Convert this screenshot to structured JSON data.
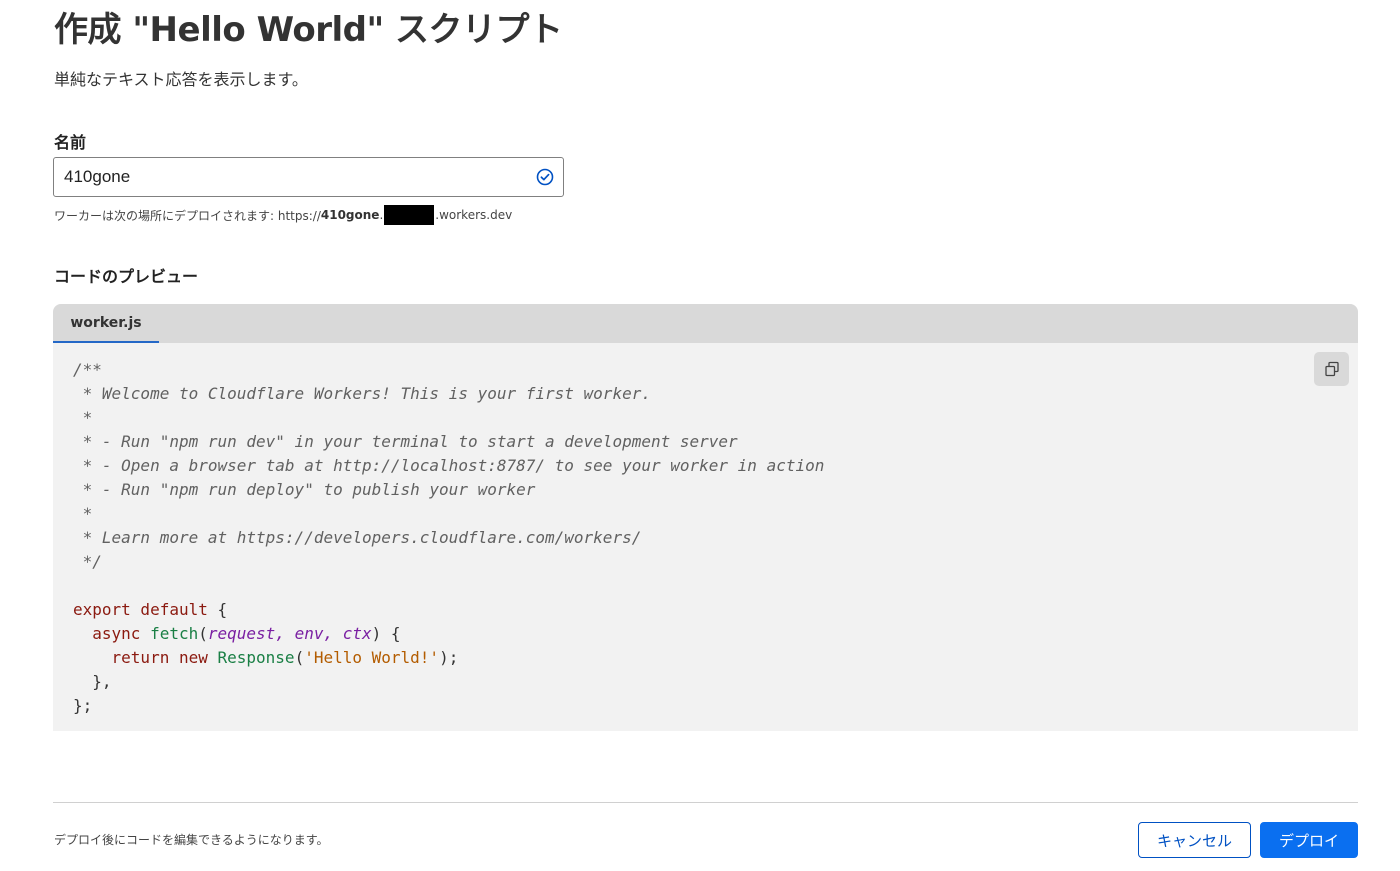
{
  "header": {
    "title": "作成 \"Hello World\" スクリプト",
    "subtitle": "単純なテキスト応答を表示します。"
  },
  "name_field": {
    "label": "名前",
    "value": "410gone",
    "status_icon": "check-circle-icon",
    "hint_prefix": "ワーカーは次の場所にデプロイされます: https://",
    "hint_name": "410gone",
    "hint_dot": ".",
    "hint_suffix": ".workers.dev"
  },
  "code_preview": {
    "label": "コードのプレビュー",
    "tab": "worker.js",
    "copy_icon": "copy-icon",
    "lines": {
      "l1": "/**",
      "l2": " * Welcome to Cloudflare Workers! This is your first worker.",
      "l3": " *",
      "l4": " * - Run \"npm run dev\" in your terminal to start a development server",
      "l5": " * - Open a browser tab at http://localhost:8787/ to see your worker in action",
      "l6": " * - Run \"npm run deploy\" to publish your worker",
      "l7": " *",
      "l8": " * Learn more at https://developers.cloudflare.com/workers/",
      "l9": " */",
      "l11_kw": "export default",
      "l11_rest": " {",
      "l12_kw": "  async ",
      "l12_fn": "fetch",
      "l12_open": "(",
      "l12_p1": "request",
      "l12_c1": ", ",
      "l12_p2": "env",
      "l12_c2": ", ",
      "l12_p3": "ctx",
      "l12_close": ") {",
      "l13_kw": "    return new ",
      "l13_fn": "Response",
      "l13_open": "(",
      "l13_str": "'Hello World!'",
      "l13_close": ");",
      "l14": "  },",
      "l15": "};"
    }
  },
  "footer": {
    "note": "デプロイ後にコードを編集できるようになります。",
    "cancel_label": "キャンセル",
    "deploy_label": "デプロイ"
  },
  "colors": {
    "primary": "#0a6ff0",
    "outline": "#0051c3",
    "tab_underline": "#2468c7",
    "code_bg": "#f2f2f2"
  }
}
